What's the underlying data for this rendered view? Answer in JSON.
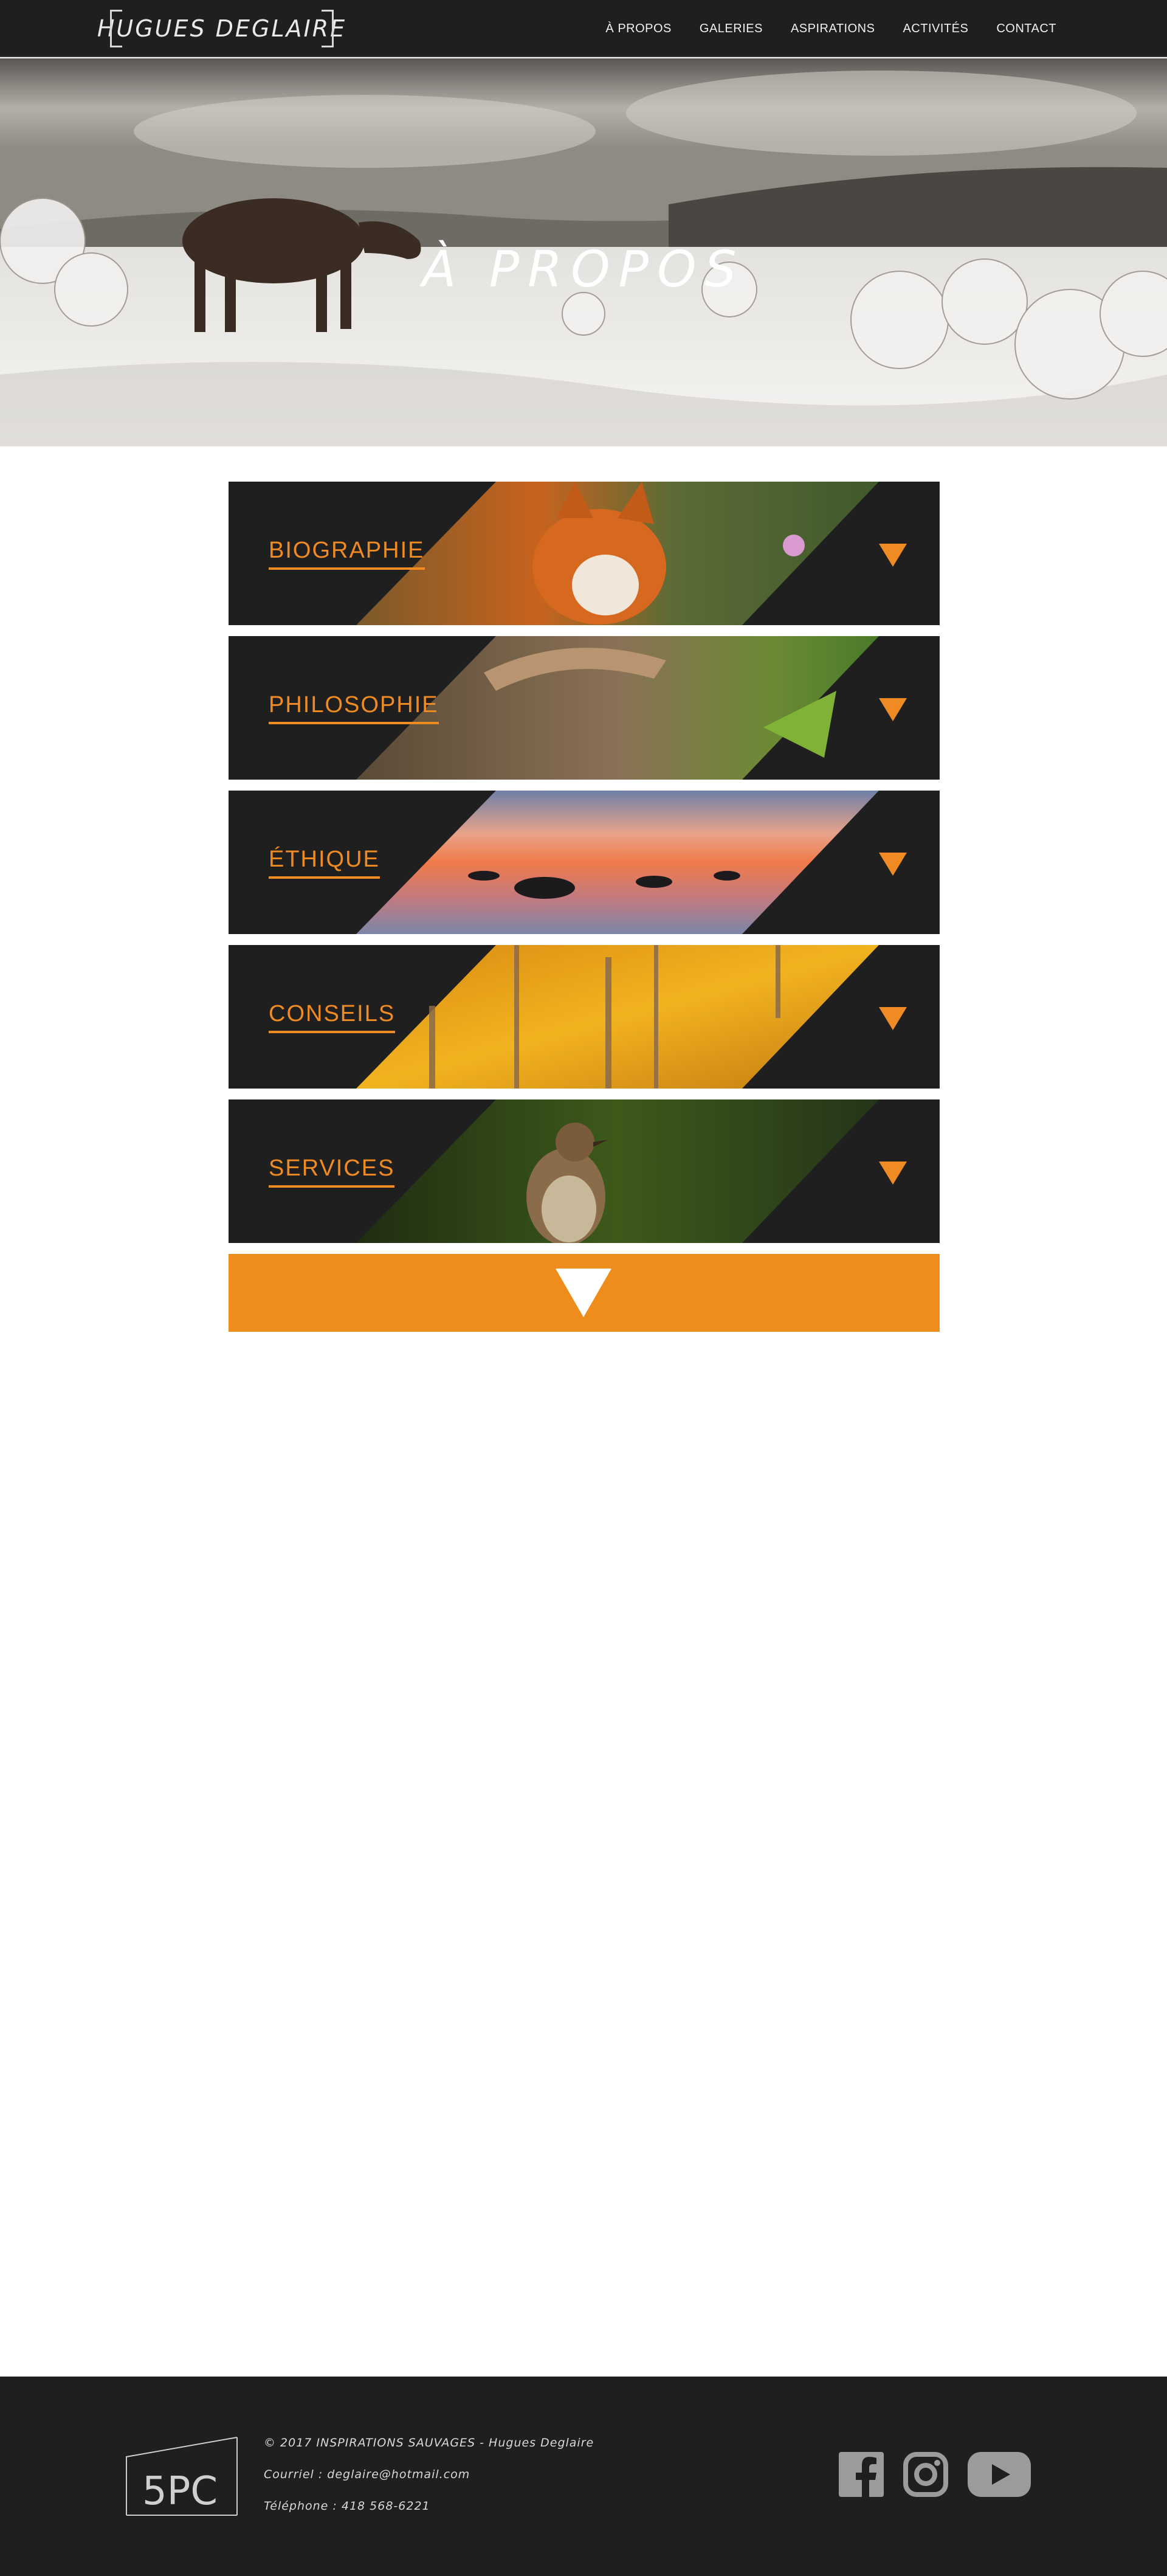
{
  "header": {
    "logo": "HUGUES DEGLAIRE",
    "nav": [
      "À PROPOS",
      "GALERIES",
      "ASPIRATIONS",
      "ACTIVITÉS",
      "CONTACT"
    ]
  },
  "hero": {
    "title": "À PROPOS"
  },
  "sections": [
    {
      "label": "BIOGRAPHIE",
      "image": "fox-photo"
    },
    {
      "label": "PHILOSOPHIE",
      "image": "moose-antler-photo"
    },
    {
      "label": "ÉTHIQUE",
      "image": "sunset-lake-photo"
    },
    {
      "label": "CONSEILS",
      "image": "autumn-forest-photo"
    },
    {
      "label": "SERVICES",
      "image": "thrush-bird-photo"
    }
  ],
  "colors": {
    "accent": "#ef8b22",
    "dark": "#1f1f20",
    "more_button": "#ee8c1c"
  },
  "footer": {
    "logo_text": "5PC",
    "copyright": "© 2017 INSPIRATIONS SAUVAGES - Hugues Deglaire",
    "email": "Courriel : deglaire@hotmail.com",
    "phone": "Téléphone : 418 568-6221",
    "social": [
      "facebook-icon",
      "instagram-icon",
      "youtube-icon"
    ]
  }
}
